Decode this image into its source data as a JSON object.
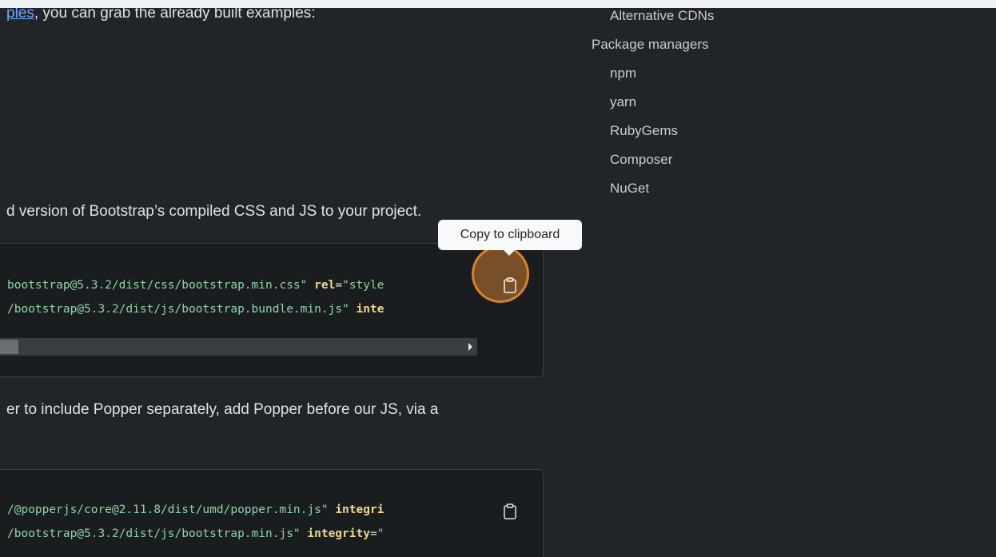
{
  "content": {
    "line1_link": "ples",
    "line1_rest": ", you can grab the already built examples:",
    "line2": "d version of Bootstrap’s compiled CSS and JS to your project.",
    "line3": "er to include Popper separately, add Popper before our JS, via a"
  },
  "code_block_1": {
    "line1_str": "bootstrap@5.3.2/dist/css/bootstrap.min.css\"",
    "line1_attr": "rel",
    "line1_eq": "=",
    "line1_val": "\"style",
    "line2_str": "/bootstrap@5.3.2/dist/js/bootstrap.bundle.min.js\"",
    "line2_attr": "inte"
  },
  "code_block_2": {
    "line1_str": "/@popperjs/core@2.11.8/dist/umd/popper.min.js\"",
    "line1_attr": "integri",
    "line2_str": "/bootstrap@5.3.2/dist/js/bootstrap.min.js\"",
    "line2_attr": "integrity",
    "line2_eq": "=",
    "line2_val": "\""
  },
  "toc": {
    "items": [
      {
        "label": "Alternative CDNs"
      },
      {
        "label": "Package managers"
      },
      {
        "label": "npm"
      },
      {
        "label": "yarn"
      },
      {
        "label": "RubyGems"
      },
      {
        "label": "Composer"
      },
      {
        "label": "NuGet"
      }
    ]
  },
  "tooltip": {
    "label": "Copy to clipboard"
  },
  "icons": {
    "copy": "clipboard-icon"
  },
  "colors": {
    "background": "#212529",
    "code_background": "#1a1d20",
    "link": "#6ea8fe",
    "string": "#8ed4a6",
    "attribute": "#f0d78c",
    "highlight": "#e68c32"
  }
}
